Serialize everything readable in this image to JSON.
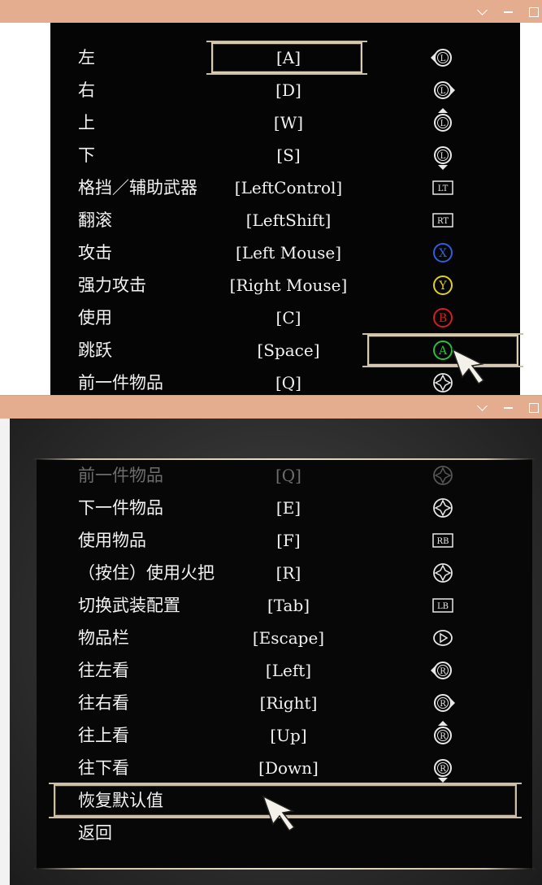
{
  "window": {
    "minimize_glyph": "minimize-icon",
    "maximize_glyph": "maximize-icon",
    "chevron_glyph": "chevron-down-icon"
  },
  "top": {
    "rows": [
      {
        "label": "左",
        "key": "[A]",
        "glyph": "left-stick-left-icon"
      },
      {
        "label": "右",
        "key": "[D]",
        "glyph": "left-stick-right-icon"
      },
      {
        "label": "上",
        "key": "[W]",
        "glyph": "left-stick-up-icon"
      },
      {
        "label": "下",
        "key": "[S]",
        "glyph": "left-stick-down-icon"
      },
      {
        "label": "格挡／辅助武器",
        "key": "[LeftControl]",
        "glyph": "lt-trigger-icon",
        "glyph_text": "LT"
      },
      {
        "label": "翻滚",
        "key": "[LeftShift]",
        "glyph": "rt-trigger-icon",
        "glyph_text": "RT"
      },
      {
        "label": "攻击",
        "key": "[Left Mouse]",
        "glyph": "x-button-icon",
        "glyph_text": "X",
        "color": "#2f5fe0"
      },
      {
        "label": "强力攻击",
        "key": "[Right Mouse]",
        "glyph": "y-button-icon",
        "glyph_text": "Y",
        "color": "#e0d21c"
      },
      {
        "label": "使用",
        "key": "[C]",
        "glyph": "b-button-icon",
        "glyph_text": "B",
        "color": "#d61e1e"
      },
      {
        "label": "跳跃",
        "key": "[Space]",
        "glyph": "a-button-icon",
        "glyph_text": "A",
        "color": "#27c03a"
      },
      {
        "label": "前一件物品",
        "key": "[Q]",
        "glyph": "dpad-left-icon"
      }
    ]
  },
  "bottom": {
    "rows": [
      {
        "label": "前一件物品",
        "key": "[Q]",
        "glyph": "dpad-left-icon",
        "dim": true
      },
      {
        "label": "下一件物品",
        "key": "[E]",
        "glyph": "dpad-right-icon"
      },
      {
        "label": "使用物品",
        "key": "[F]",
        "glyph": "rb-bumper-icon",
        "glyph_text": "RB"
      },
      {
        "label": "（按住）使用火把",
        "key": "[R]",
        "glyph": "dpad-down-icon"
      },
      {
        "label": "切换武装配置",
        "key": "[Tab]",
        "glyph": "lb-bumper-icon",
        "glyph_text": "LB"
      },
      {
        "label": "物品栏",
        "key": "[Escape]",
        "glyph": "menu-button-icon"
      },
      {
        "label": "往左看",
        "key": "[Left]",
        "glyph": "right-stick-left-icon"
      },
      {
        "label": "往右看",
        "key": "[Right]",
        "glyph": "right-stick-right-icon"
      },
      {
        "label": "往上看",
        "key": "[Up]",
        "glyph": "right-stick-up-icon"
      },
      {
        "label": "往下看",
        "key": "[Down]",
        "glyph": "right-stick-down-icon"
      }
    ],
    "reset_label": "恢复默认值",
    "back_label": "返回"
  }
}
